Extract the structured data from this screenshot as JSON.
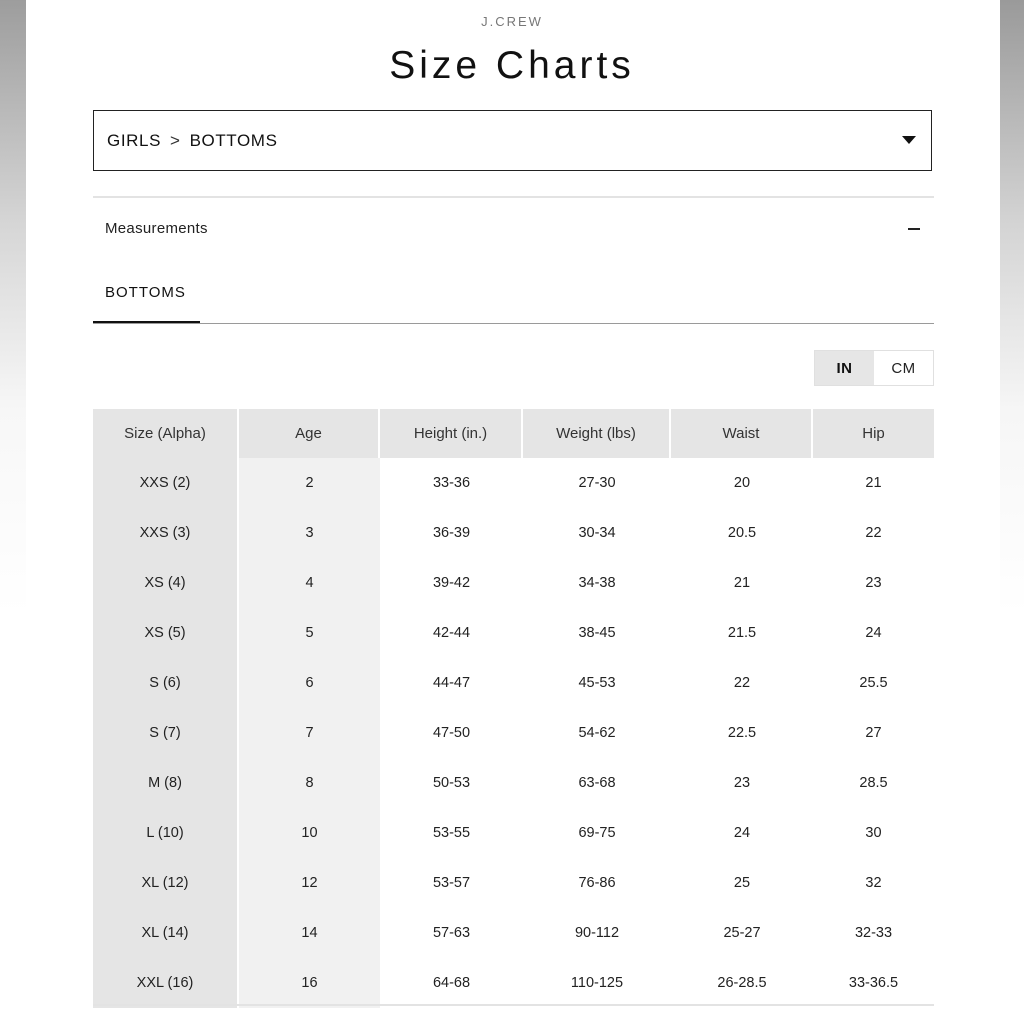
{
  "brand": "J.CREW",
  "page_title": "Size Charts",
  "category_select": {
    "path": [
      "GIRLS",
      "BOTTOMS"
    ],
    "separator": ">"
  },
  "section": {
    "label": "Measurements",
    "toggle_icon": "minus-icon"
  },
  "tabs": [
    {
      "label": "BOTTOMS",
      "active": true
    }
  ],
  "unit_toggle": {
    "options": [
      "IN",
      "CM"
    ],
    "selected": "IN"
  },
  "table": {
    "headers": [
      "Size (Alpha)",
      "Age",
      "Height (in.)",
      "Weight (lbs)",
      "Waist",
      "Hip"
    ],
    "rows": [
      [
        "XXS (2)",
        "2",
        "33-36",
        "27-30",
        "20",
        "21"
      ],
      [
        "XXS (3)",
        "3",
        "36-39",
        "30-34",
        "20.5",
        "22"
      ],
      [
        "XS (4)",
        "4",
        "39-42",
        "34-38",
        "21",
        "23"
      ],
      [
        "XS (5)",
        "5",
        "42-44",
        "38-45",
        "21.5",
        "24"
      ],
      [
        "S (6)",
        "6",
        "44-47",
        "45-53",
        "22",
        "25.5"
      ],
      [
        "S (7)",
        "7",
        "47-50",
        "54-62",
        "22.5",
        "27"
      ],
      [
        "M (8)",
        "8",
        "50-53",
        "63-68",
        "23",
        "28.5"
      ],
      [
        "L (10)",
        "10",
        "53-55",
        "69-75",
        "24",
        "30"
      ],
      [
        "XL (12)",
        "12",
        "53-57",
        "76-86",
        "25",
        "32"
      ],
      [
        "XL (14)",
        "14",
        "57-63",
        "90-112",
        "25-27",
        "32-33"
      ],
      [
        "XXL (16)",
        "16",
        "64-68",
        "110-125",
        "26-28.5",
        "33-36.5"
      ]
    ]
  },
  "colors": {
    "header_bg": "#e5e5e5",
    "age_col_bg": "#f1f1f1",
    "text": "#222222"
  }
}
